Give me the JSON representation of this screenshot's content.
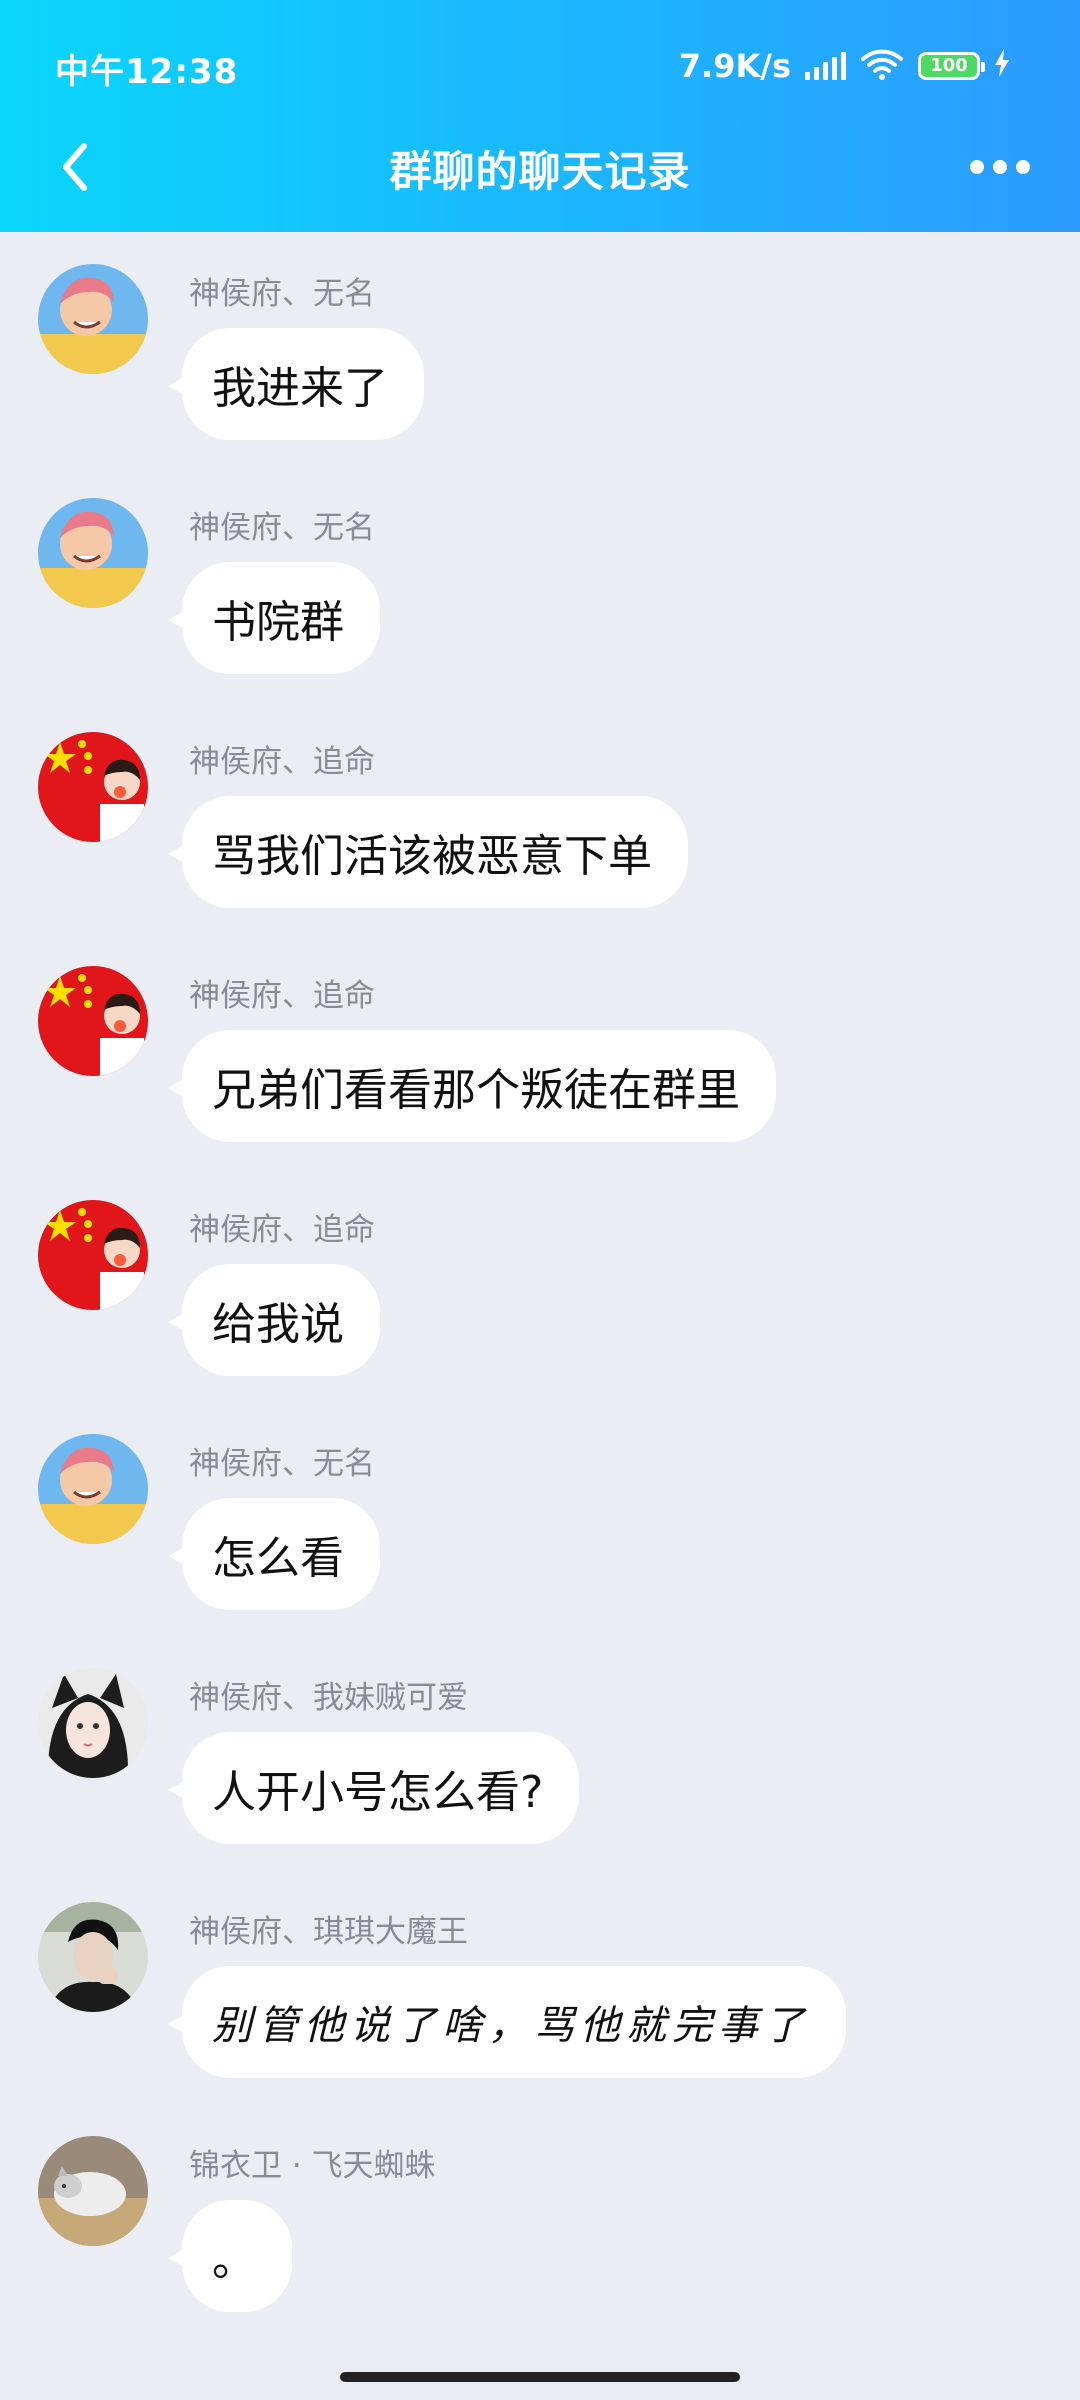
{
  "status_bar": {
    "time": "中午12:38",
    "net_speed": "7.9K/s",
    "battery": "100"
  },
  "header": {
    "title": "群聊的聊天记录",
    "back_icon": "chevron-left-icon",
    "more_icon": "more-dots-icon"
  },
  "colors": {
    "header_start": "#0ad6fb",
    "header_end": "#2c9bff",
    "background": "#ebedf5",
    "bubble": "#ffffff",
    "sender_text": "#888c96"
  },
  "messages": [
    {
      "sender": "神侯府、无名",
      "text": "我进来了",
      "avatar": "anime-boy-avatar"
    },
    {
      "sender": "神侯府、无名",
      "text": "书院群",
      "avatar": "anime-boy-avatar"
    },
    {
      "sender": "神侯府、追命",
      "text": "骂我们活该被恶意下单",
      "avatar": "flag-girl-avatar"
    },
    {
      "sender": "神侯府、追命",
      "text": "兄弟们看看那个叛徒在群里",
      "avatar": "flag-girl-avatar"
    },
    {
      "sender": "神侯府、追命",
      "text": "给我说",
      "avatar": "flag-girl-avatar"
    },
    {
      "sender": "神侯府、无名",
      "text": "怎么看",
      "avatar": "anime-boy-avatar"
    },
    {
      "sender": "神侯府、我妹贼可爱",
      "text": "人开小号怎么看?",
      "avatar": "cat-ear-girl-avatar"
    },
    {
      "sender": "神侯府、琪琪大魔王",
      "text": "别管他说了啥，骂他就完事了",
      "avatar": "boy-photo-avatar"
    },
    {
      "sender": "锦衣卫 · 飞天蜘蛛",
      "text": "。",
      "avatar": "cat-photo-avatar"
    }
  ]
}
